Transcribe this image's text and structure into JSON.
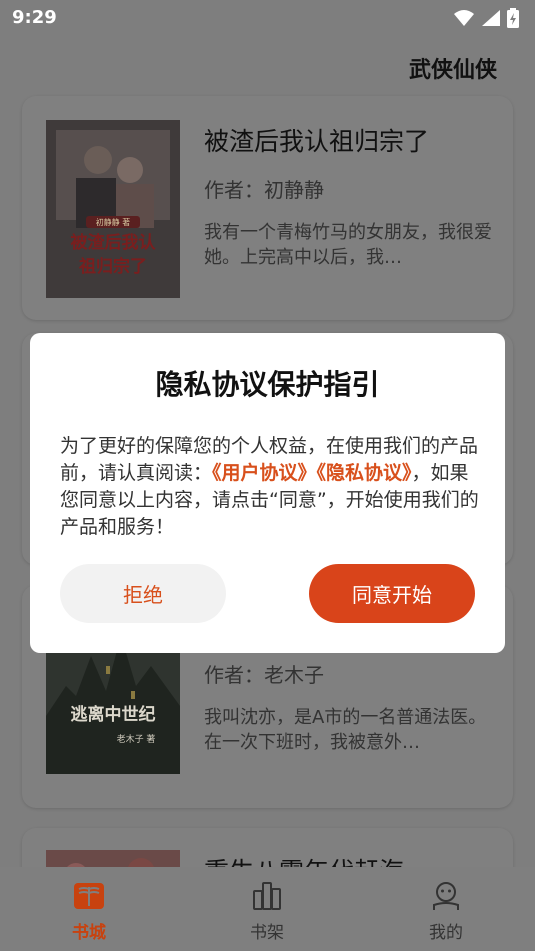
{
  "status_bar": {
    "time": "9:29"
  },
  "header": {
    "category": "武侠仙侠"
  },
  "books": [
    {
      "title": "被渣后我认祖归宗了",
      "author": "作者：初静静",
      "desc": "我有一个青梅竹马的女朋友，我很爱她。上完高中以后，我…",
      "cover_title": "被渣后我认祖归宗了",
      "cover_author": "初静静 著"
    },
    {
      "title": "",
      "author": "作者：老木子",
      "desc": "我叫沈亦，是A市的一名普通法医。在一次下班时，我被意外…",
      "cover_title": "逃离中世纪",
      "cover_author": "老木子 著"
    },
    {
      "title": "重生八零年代赶海",
      "author": "",
      "desc": ""
    }
  ],
  "dialog": {
    "title": "隐私协议保护指引",
    "text_before": "为了更好的保障您的个人权益，在使用我们的产品前，请认真阅读：",
    "link_user": "《用户协议》",
    "link_privacy": "《隐私协议》",
    "text_after": "，如果您同意以上内容，请点击“同意”，开始使用我们的产品和服务！",
    "reject_label": "拒绝",
    "agree_label": "同意开始"
  },
  "bottom_nav": {
    "items": [
      {
        "label": "书城",
        "icon": "book-icon",
        "active": true
      },
      {
        "label": "书架",
        "icon": "bookshelf-icon",
        "active": false
      },
      {
        "label": "我的",
        "icon": "profile-icon",
        "active": false
      }
    ]
  },
  "colors": {
    "accent": "#d9441a",
    "overlay": "#7f7f7f"
  }
}
